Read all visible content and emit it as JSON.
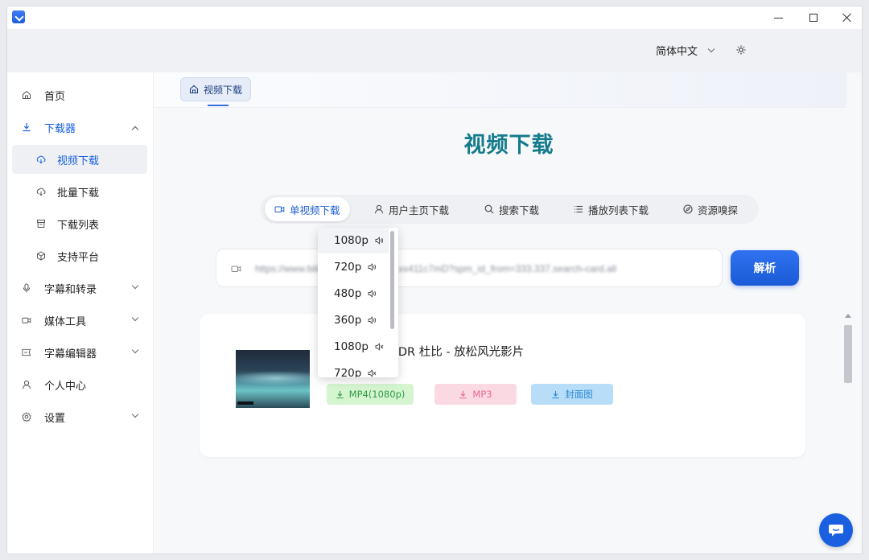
{
  "header": {
    "language": "简体中文"
  },
  "sidebar": {
    "items": [
      {
        "label": "首页"
      },
      {
        "label": "下载器"
      },
      {
        "label": "视频下载"
      },
      {
        "label": "批量下载"
      },
      {
        "label": "下载列表"
      },
      {
        "label": "支持平台"
      },
      {
        "label": "字幕和转录"
      },
      {
        "label": "媒体工具"
      },
      {
        "label": "字幕编辑器"
      },
      {
        "label": "个人中心"
      },
      {
        "label": "设置"
      }
    ]
  },
  "tab": {
    "label": "视频下载"
  },
  "page": {
    "title": "视频下载"
  },
  "modes": [
    {
      "label": "单视频下载"
    },
    {
      "label": "用户主页下载"
    },
    {
      "label": "搜索下载"
    },
    {
      "label": "播放列表下载"
    },
    {
      "label": "资源嗅探"
    }
  ],
  "url": {
    "value": "https://www.bilibili.com/video/BV1xx411c7mD?spm_id_from=333.337.search-card.all"
  },
  "parse_label": "解析",
  "result": {
    "title": "世界风景 4K HDR 杜比 - 放松风光影片",
    "buttons": {
      "mp4": "MP4(1080p)",
      "mp3": "MP3",
      "cover": "封面图"
    }
  },
  "dropdown": {
    "options": [
      {
        "label": "1080p",
        "audio": "sound-icon"
      },
      {
        "label": "720p",
        "audio": "sound-icon"
      },
      {
        "label": "480p",
        "audio": "sound-icon"
      },
      {
        "label": "360p",
        "audio": "sound-icon"
      },
      {
        "label": "1080p",
        "audio": "mute-icon"
      },
      {
        "label": "720p",
        "audio": "mute-icon"
      }
    ]
  },
  "colors": {
    "accent": "#1a5fe0",
    "title": "#137b8c"
  }
}
